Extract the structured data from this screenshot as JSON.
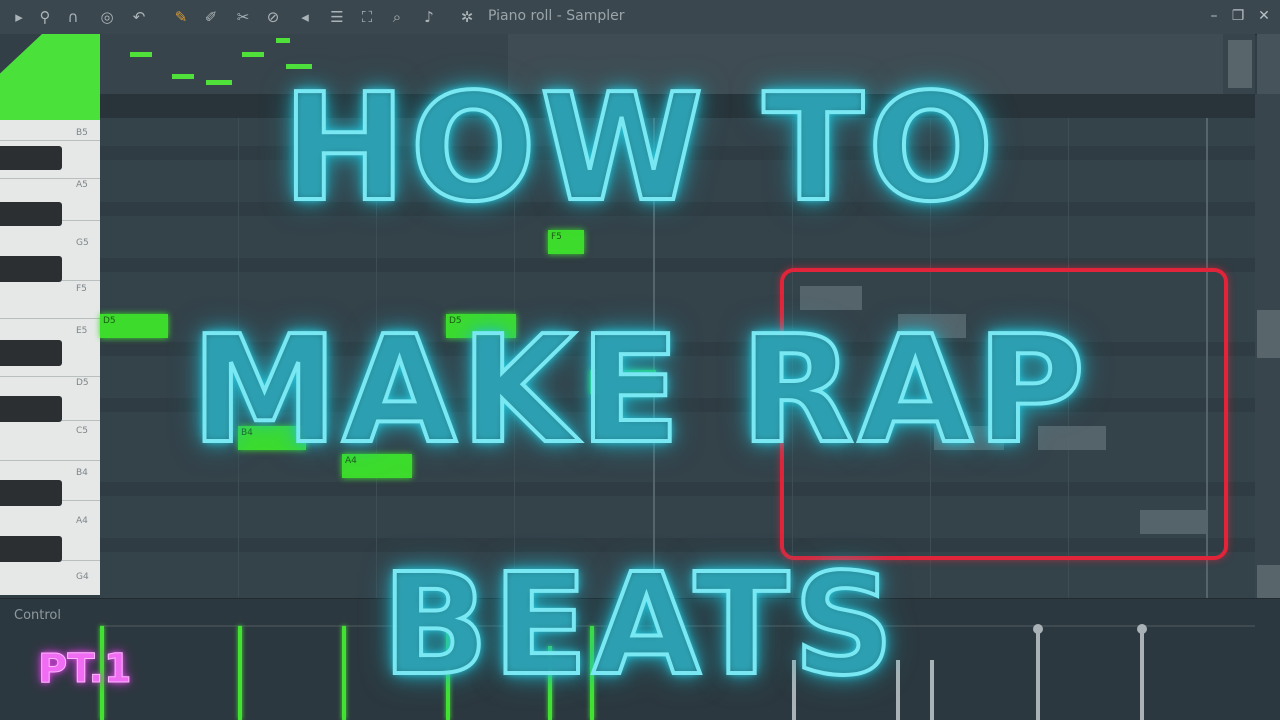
{
  "toolbar": {
    "title": "Piano roll - Sampler",
    "icons": [
      "play-icon",
      "magnet-icon",
      "stamp-icon",
      "target-icon",
      "undo-icon",
      "pencil-icon",
      "paint-icon",
      "delete-icon",
      "mute-icon",
      "slice-icon",
      "select-icon",
      "zoom-icon",
      "speaker-icon",
      "settings-icon"
    ],
    "window_controls": [
      "minimize-icon",
      "maximize-icon",
      "close-icon"
    ]
  },
  "keyboard": {
    "labels": [
      "B5",
      "A5",
      "G5",
      "F5",
      "E5",
      "D5",
      "C5",
      "B4",
      "A4",
      "G4"
    ]
  },
  "control": {
    "label": "Control"
  },
  "overlay": {
    "line1": "HOW TO",
    "line2": "MAKE RAP",
    "line3": "BEATS",
    "part": "PT.1"
  },
  "colors": {
    "note_green": "#3ddc2c",
    "neon_cyan": "#7ae8f2",
    "highlight_red": "#e0243a",
    "part_pink": "#f06cf2"
  }
}
